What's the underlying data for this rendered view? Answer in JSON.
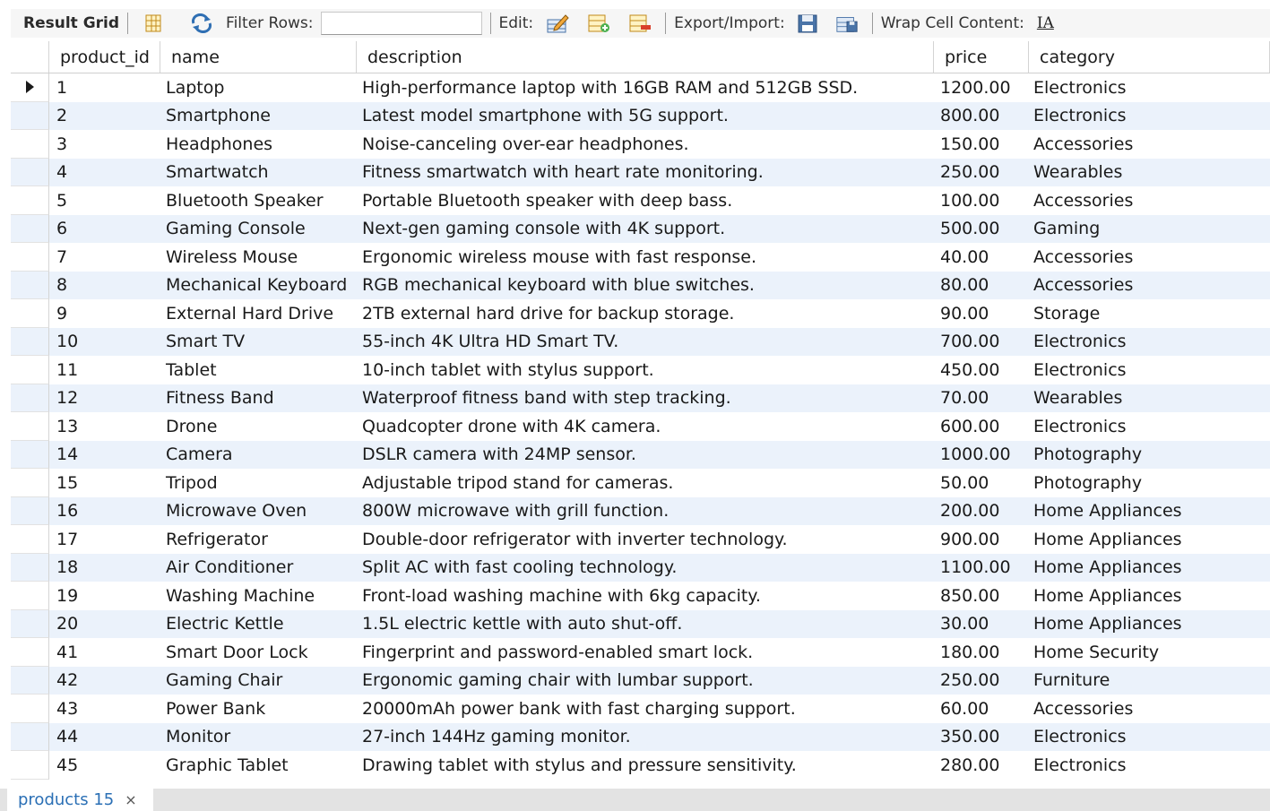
{
  "toolbar": {
    "result_grid_label": "Result Grid",
    "filter_rows_label": "Filter Rows:",
    "filter_rows_value": "",
    "edit_label": "Edit:",
    "export_import_label": "Export/Import:",
    "wrap_cell_label": "Wrap Cell Content:",
    "wrap_icon_glyph": "IA"
  },
  "grid": {
    "columns": [
      "product_id",
      "name",
      "description",
      "price",
      "category"
    ],
    "rows": [
      {
        "id": "1",
        "name": "Laptop",
        "description": "High-performance laptop with 16GB RAM and 512GB SSD.",
        "price": "1200.00",
        "category": "Electronics"
      },
      {
        "id": "2",
        "name": "Smartphone",
        "description": "Latest model smartphone with 5G support.",
        "price": "800.00",
        "category": "Electronics"
      },
      {
        "id": "3",
        "name": "Headphones",
        "description": "Noise-canceling over-ear headphones.",
        "price": "150.00",
        "category": "Accessories"
      },
      {
        "id": "4",
        "name": "Smartwatch",
        "description": "Fitness smartwatch with heart rate monitoring.",
        "price": "250.00",
        "category": "Wearables"
      },
      {
        "id": "5",
        "name": "Bluetooth Speaker",
        "description": "Portable Bluetooth speaker with deep bass.",
        "price": "100.00",
        "category": "Accessories"
      },
      {
        "id": "6",
        "name": "Gaming Console",
        "description": "Next-gen gaming console with 4K support.",
        "price": "500.00",
        "category": "Gaming"
      },
      {
        "id": "7",
        "name": "Wireless Mouse",
        "description": "Ergonomic wireless mouse with fast response.",
        "price": "40.00",
        "category": "Accessories"
      },
      {
        "id": "8",
        "name": "Mechanical Keyboard",
        "description": "RGB mechanical keyboard with blue switches.",
        "price": "80.00",
        "category": "Accessories"
      },
      {
        "id": "9",
        "name": "External Hard Drive",
        "description": "2TB external hard drive for backup storage.",
        "price": "90.00",
        "category": "Storage"
      },
      {
        "id": "10",
        "name": "Smart TV",
        "description": "55-inch 4K Ultra HD Smart TV.",
        "price": "700.00",
        "category": "Electronics"
      },
      {
        "id": "11",
        "name": "Tablet",
        "description": "10-inch tablet with stylus support.",
        "price": "450.00",
        "category": "Electronics"
      },
      {
        "id": "12",
        "name": "Fitness Band",
        "description": "Waterproof fitness band with step tracking.",
        "price": "70.00",
        "category": "Wearables"
      },
      {
        "id": "13",
        "name": "Drone",
        "description": "Quadcopter drone with 4K camera.",
        "price": "600.00",
        "category": "Electronics"
      },
      {
        "id": "14",
        "name": "Camera",
        "description": "DSLR camera with 24MP sensor.",
        "price": "1000.00",
        "category": "Photography"
      },
      {
        "id": "15",
        "name": "Tripod",
        "description": "Adjustable tripod stand for cameras.",
        "price": "50.00",
        "category": "Photography"
      },
      {
        "id": "16",
        "name": "Microwave Oven",
        "description": "800W microwave with grill function.",
        "price": "200.00",
        "category": "Home Appliances"
      },
      {
        "id": "17",
        "name": "Refrigerator",
        "description": "Double-door refrigerator with inverter technology.",
        "price": "900.00",
        "category": "Home Appliances"
      },
      {
        "id": "18",
        "name": "Air Conditioner",
        "description": "Split AC with fast cooling technology.",
        "price": "1100.00",
        "category": "Home Appliances"
      },
      {
        "id": "19",
        "name": "Washing Machine",
        "description": "Front-load washing machine with 6kg capacity.",
        "price": "850.00",
        "category": "Home Appliances"
      },
      {
        "id": "20",
        "name": "Electric Kettle",
        "description": "1.5L electric kettle with auto shut-off.",
        "price": "30.00",
        "category": "Home Appliances"
      },
      {
        "id": "41",
        "name": "Smart Door Lock",
        "description": "Fingerprint and password-enabled smart lock.",
        "price": "180.00",
        "category": "Home Security"
      },
      {
        "id": "42",
        "name": "Gaming Chair",
        "description": "Ergonomic gaming chair with lumbar support.",
        "price": "250.00",
        "category": "Furniture"
      },
      {
        "id": "43",
        "name": "Power Bank",
        "description": "20000mAh power bank with fast charging support.",
        "price": "60.00",
        "category": "Accessories"
      },
      {
        "id": "44",
        "name": "Monitor",
        "description": "27-inch 144Hz gaming monitor.",
        "price": "350.00",
        "category": "Electronics"
      },
      {
        "id": "45",
        "name": "Graphic Tablet",
        "description": "Drawing tablet with stylus and pressure sensitivity.",
        "price": "280.00",
        "category": "Electronics"
      }
    ]
  },
  "tabs": [
    {
      "label": "products 15",
      "close_glyph": "×"
    }
  ],
  "colors": {
    "toolbar_bg": "#f6f6f6",
    "row_alt_bg": "#ebf2fb",
    "tab_text": "#2a6fb5"
  }
}
